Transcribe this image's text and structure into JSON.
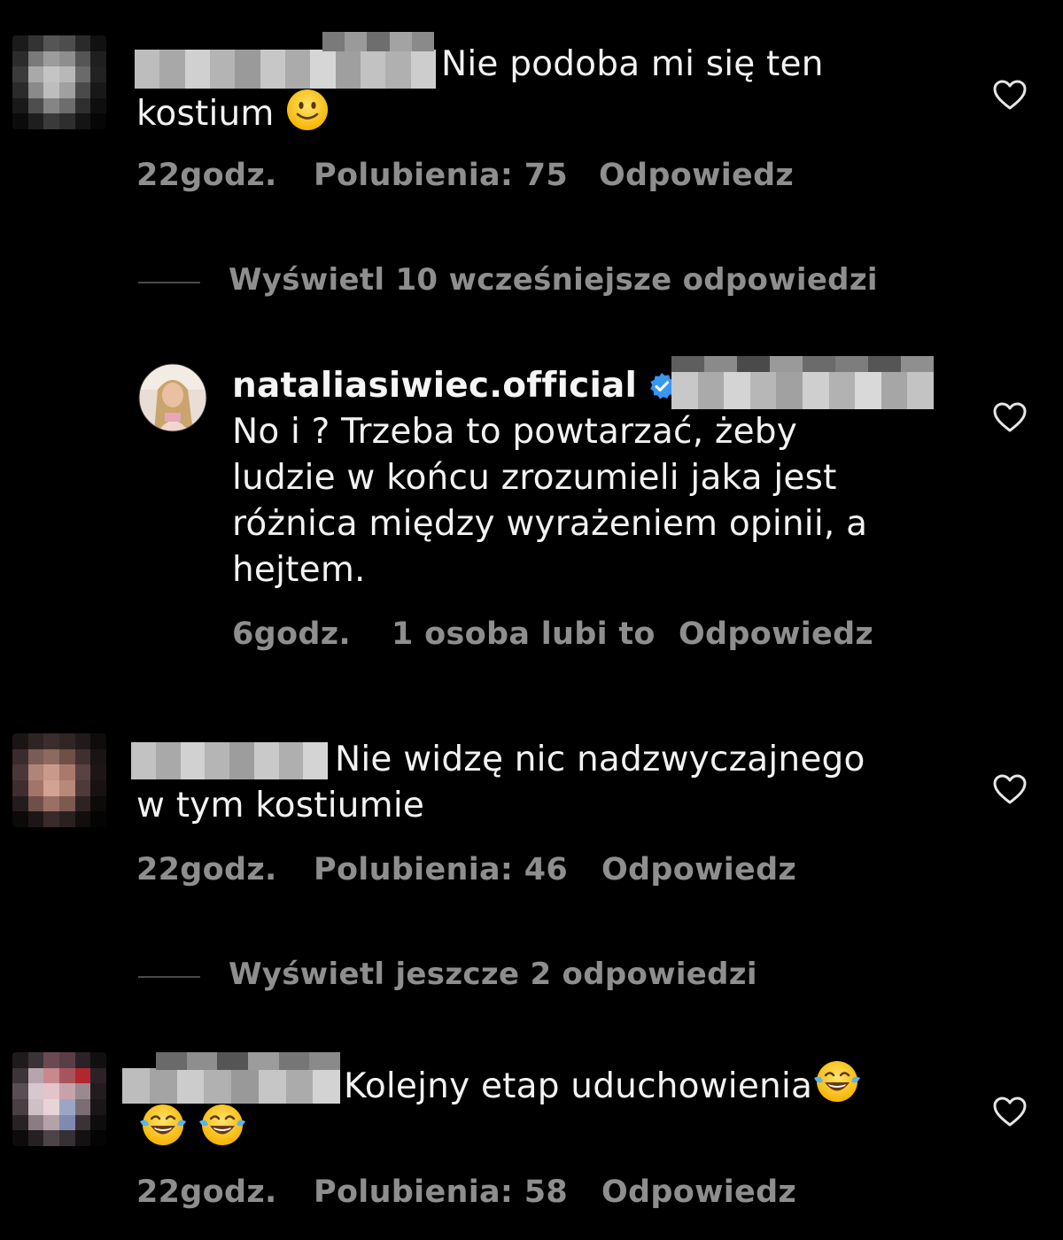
{
  "comments": [
    {
      "text_line1": "Nie podoba mi się ten",
      "text_line2": "kostium",
      "time": "22godz.",
      "likes": "Polubienia: 75",
      "reply": "Odpowiedz"
    },
    {
      "text_line1": "Nie widzę nic nadzwyczajnego",
      "text_line2": "w tym kostiumie",
      "time": "22godz.",
      "likes": "Polubienia: 46",
      "reply": "Odpowiedz"
    },
    {
      "text_line1": "Kolejny etap uduchowienia",
      "time": "22godz.",
      "likes": "Polubienia: 58",
      "reply": "Odpowiedz"
    }
  ],
  "view_replies_1": "Wyświetl 10 wcześniejsze odpowiedzi",
  "view_replies_2": "Wyświetl jeszcze 2 odpowiedzi",
  "reply_comment": {
    "username": "nataliasiwiec.official",
    "line1": "No i ? Trzeba to powtarzać, żeby",
    "line2": "ludzie w końcu zrozumieli jaka jest",
    "line3": "różnica między wyrażeniem opinii, a",
    "line4": "hejtem.",
    "time": "6godz.",
    "likes": "1 osoba lubi to",
    "reply": "Odpowiedz"
  },
  "icons": {
    "heart": "heart-icon",
    "verified": "verified-badge-icon",
    "smile": "slightly-smiling-face-emoji",
    "laugh": "face-with-tears-of-joy-emoji"
  },
  "colors": {
    "background": "#000000",
    "text": "#f2f2f2",
    "meta": "#8e8e8e",
    "verified": "#3897f0"
  }
}
